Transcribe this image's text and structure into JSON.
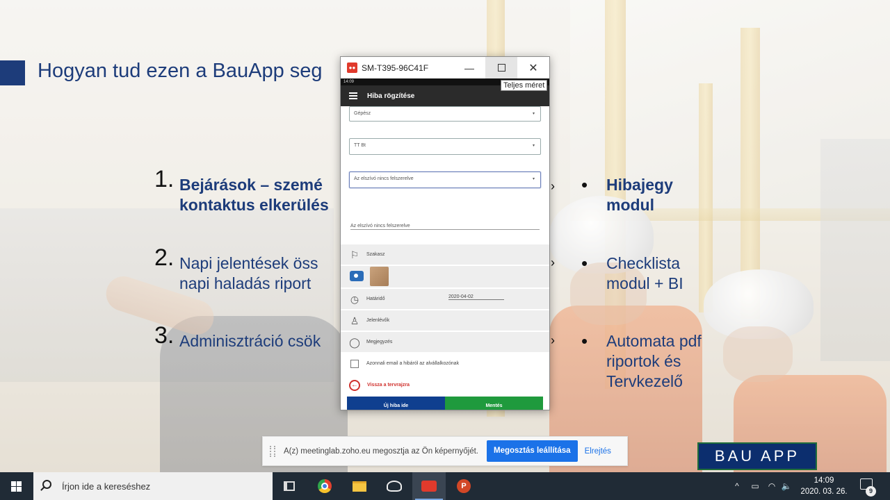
{
  "slide": {
    "title": "Hogyan tud ezen a BauApp seg",
    "items": [
      {
        "num": "1.",
        "lines": [
          "Bejárások – szemé",
          "kontaktus elkerülés"
        ]
      },
      {
        "num": "2.",
        "lines": [
          "Napi jelentések öss",
          "napi haladás riport"
        ]
      },
      {
        "num": "3.",
        "lines": [
          "Adminisztráció csök",
          ""
        ]
      }
    ],
    "arrows": [
      "›",
      "›",
      "›"
    ],
    "bullets": [
      {
        "dot": "•",
        "lines": [
          "Hibajegy",
          "modul"
        ]
      },
      {
        "dot": "•",
        "lines": [
          "Checklista",
          "modul + BI",
          ""
        ]
      },
      {
        "dot": "•",
        "lines": [
          "Automata pdf",
          "riportok és",
          "Tervkezelő"
        ]
      }
    ]
  },
  "window": {
    "title": "SM-T395-96C41F",
    "logo_text": "●●",
    "minimize": "—",
    "close": "✕",
    "tooltip": "Teljes méret"
  },
  "phone": {
    "status_time": "14:09",
    "appbar_title": "Hiba rögzítése",
    "dropdown_1": "Gépész",
    "dropdown_2": "TT Bt",
    "dropdown_3": "Az elszívó nincs felszerelve",
    "caret": "▾",
    "description": "Az elszívó nincs felszerelve",
    "section_label": "Szakasz",
    "deadline_label": "Határidő",
    "deadline_value": "2020-04-02",
    "reporters_label": "Jelenlévők",
    "comment_label": "Megjegyzés",
    "email_label": "Azonnali email a hibáról az alvállalkozónak",
    "back_label": "Vissza a tervrajzra",
    "back_icon": "←",
    "new_button": "Új hiba ide",
    "save_button": "Mentés"
  },
  "share_banner": {
    "message": "A(z) meetinglab.zoho.eu megosztja az Ön képernyőjét.",
    "stop_button": "Megosztás leállítása",
    "hide_link": "Elrejtés"
  },
  "brand_logo": "BAU APP",
  "taskbar": {
    "search_placeholder": "Írjon ide a kereséshez",
    "ppt_letter": "P",
    "tray_chevron": "^",
    "tray_volume": "🔈",
    "tray_lang": "",
    "time": "14:09",
    "date": "2020. 03. 26.",
    "notification_count": "9"
  },
  "colors": {
    "accent_blue": "#1d3c7a",
    "save_green": "#1f9a3d",
    "new_blue": "#0f3f8f",
    "share_blue": "#1b72e8"
  }
}
